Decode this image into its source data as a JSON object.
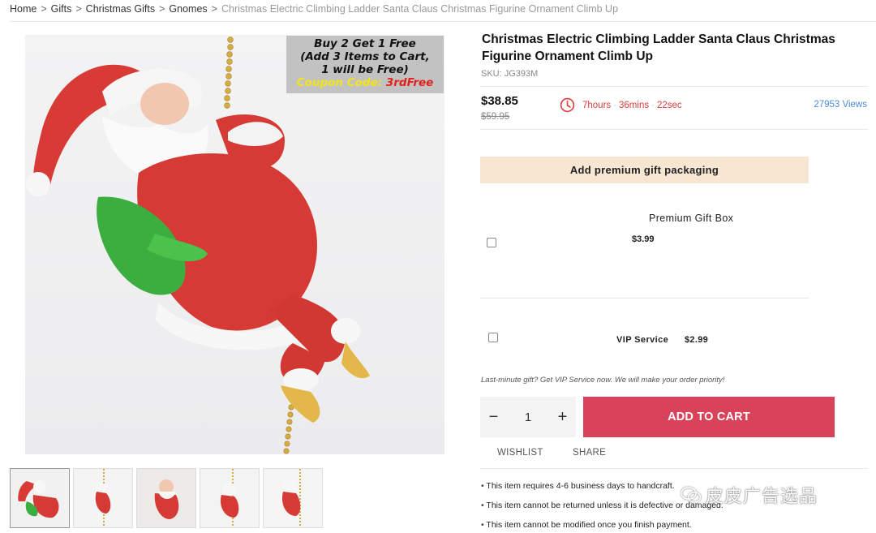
{
  "breadcrumb": {
    "items": [
      "Home",
      "Gifts",
      "Christmas Gifts",
      "Gnomes"
    ],
    "current": "Christmas Electric Climbing Ladder Santa Claus Christmas Figurine Ornament Climb Up",
    "separator": ">"
  },
  "gallery": {
    "promo": {
      "line1": "Buy 2 Get 1 Free",
      "line2": "(Add 3 Items to Cart,",
      "line3": "1 will be Free)",
      "coupon_label": "Coupon Code: ",
      "coupon_code": "3rdFree"
    },
    "thumbnail_count": 5
  },
  "product": {
    "title": "Christmas Electric Climbing Ladder Santa Claus Christmas Figurine Ornament Climb Up",
    "sku": "SKU: JG393M",
    "price": "$38.85",
    "old_price": "$59.95",
    "views": "27953 Views"
  },
  "countdown": {
    "hours": "7hours",
    "mins": "36mins",
    "secs": "22sec",
    "icon": "clock-icon",
    "color": "#e03b3b"
  },
  "gift": {
    "bar_label": "Add premium gift packaging",
    "box_title": "Premium Gift Box",
    "box_price": "$3.99",
    "vip_label": "VIP Service",
    "vip_price": "$2.99",
    "note": "Last-minute gift? Get VIP Service now. We will make your order priority!"
  },
  "purchase": {
    "minus": "−",
    "quantity": "1",
    "plus": "+",
    "add_to_cart": "ADD TO CART",
    "accent_color": "#d8435a",
    "wishlist": "WISHLIST",
    "share": "SHARE"
  },
  "policies": [
    "This item requires 4-6 business days to handcraft.",
    "This item cannot be returned unless it is defective or damaged.",
    "This item cannot be modified once you finish payment."
  ],
  "watermark": {
    "text": "皮皮广告选品",
    "icon": "wechat-icon"
  }
}
